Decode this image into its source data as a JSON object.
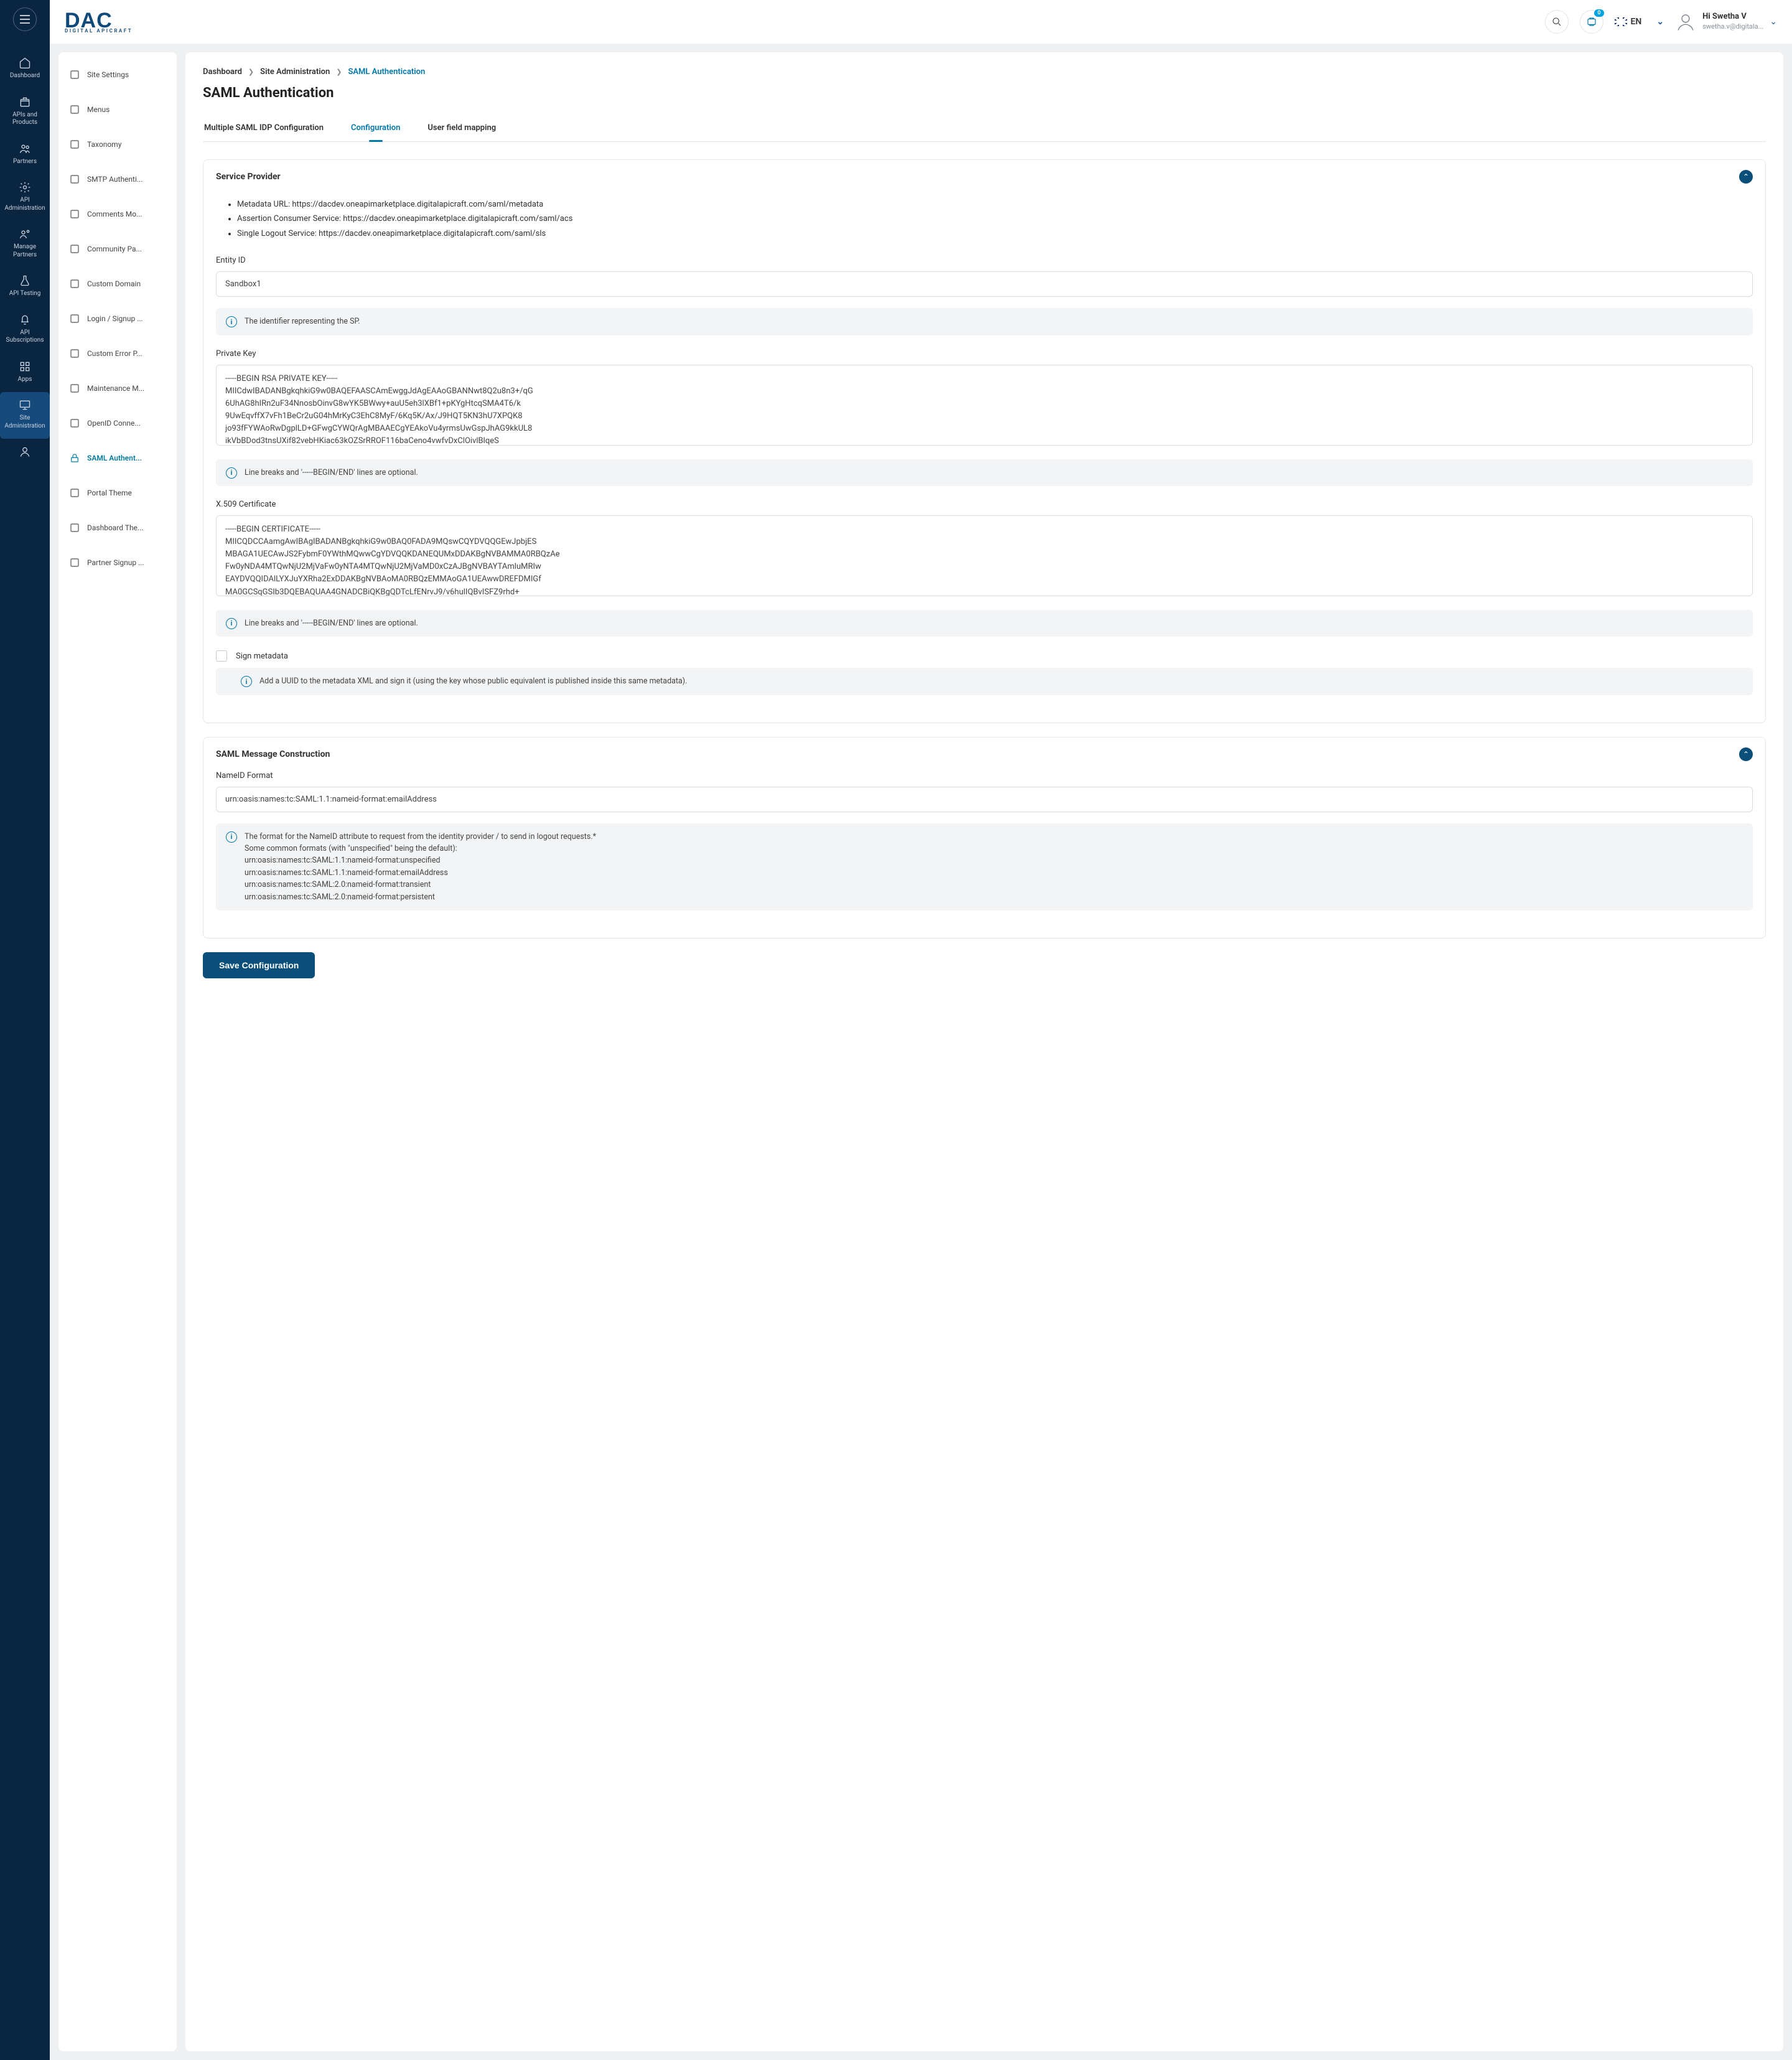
{
  "header": {
    "logo_main": "DAC",
    "logo_sub": "DIGITAL APICRAFT",
    "notif_badge": "0",
    "lang_label": "EN",
    "user_greeting": "Hi Swetha V",
    "user_email": "swetha.v@digitala..."
  },
  "rail": [
    {
      "label": "Dashboard",
      "icon": "home"
    },
    {
      "label": "APIs and Products",
      "icon": "package"
    },
    {
      "label": "Partners",
      "icon": "users"
    },
    {
      "label": "API Administration",
      "icon": "gear"
    },
    {
      "label": "Manage Partners",
      "icon": "gear-users"
    },
    {
      "label": "API Testing",
      "icon": "flask"
    },
    {
      "label": "API Subscriptions",
      "icon": "bell"
    },
    {
      "label": "Apps",
      "icon": "grid"
    },
    {
      "label": "Site Administration",
      "icon": "monitor",
      "active": true
    },
    {
      "label": "",
      "icon": "person"
    }
  ],
  "settings_nav": [
    {
      "label": "Site Settings",
      "icon": "gear"
    },
    {
      "label": "Menus",
      "icon": "grid"
    },
    {
      "label": "Taxonomy",
      "icon": "branch"
    },
    {
      "label": "SMTP Authenti...",
      "icon": "mail-lock"
    },
    {
      "label": "Comments Mo...",
      "icon": "chat"
    },
    {
      "label": "Community Pa...",
      "icon": "person"
    },
    {
      "label": "Custom Domain",
      "icon": "globe"
    },
    {
      "label": "Login / Signup ...",
      "icon": "login"
    },
    {
      "label": "Custom Error P...",
      "icon": "warning"
    },
    {
      "label": "Maintenance M...",
      "icon": "wrench"
    },
    {
      "label": "OpenID Conne...",
      "icon": "openid"
    },
    {
      "label": "SAML Authent...",
      "icon": "lock",
      "active": true
    },
    {
      "label": "Portal Theme",
      "icon": "theme"
    },
    {
      "label": "Dashboard The...",
      "icon": "dash-theme"
    },
    {
      "label": "Partner Signup ...",
      "icon": "signup"
    }
  ],
  "breadcrumbs": {
    "a": "Dashboard",
    "b": "Site Administration",
    "c": "SAML Authentication"
  },
  "page_title": "SAML Authentication",
  "tabs": [
    {
      "label": "Multiple SAML IDP Configuration"
    },
    {
      "label": "Configuration",
      "active": true
    },
    {
      "label": "User field mapping"
    }
  ],
  "sp": {
    "title": "Service Provider",
    "metadata": [
      "Metadata URL: https://dacdev.oneapimarketplace.digitalapicraft.com/saml/metadata",
      "Assertion Consumer Service: https://dacdev.oneapimarketplace.digitalapicraft.com/saml/acs",
      "Single Logout Service: https://dacdev.oneapimarketplace.digitalapicraft.com/saml/sls"
    ],
    "entity_id_label": "Entity ID",
    "entity_id_value": "Sandbox1",
    "entity_id_help": "The identifier representing the SP.",
    "private_key_label": "Private Key",
    "private_key_value": "-----BEGIN RSA PRIVATE KEY-----\nMIICdwIBADANBgkqhkiG9w0BAQEFAASCAmEwggJdAgEAAoGBANNwt8Q2u8n3+/qG\n6UhAG8hIRn2uF34NnosbOinvG8wYK5BWwy+auU5eh3lXBf1+pKYgHtcqSMA4T6/k\n9UwEqvffX7vFh1BeCr2uG04hMrKyC3EhC8MyF/6Kq5K/Ax/J9HQT5KN3hU7XPQK8\njo93fFYWAoRwDgplLD+GFwgCYWQrAgMBAAECgYEAkoVu4yrmsUwGspJhAG9kkUL8\nikVbBDod3tnsUXif82vebHKiac63kOZSrRROF116baCeno4vwfvDxClOivlBlqeS",
    "private_key_help": "Line breaks and '-----BEGIN/END' lines are optional.",
    "cert_label": "X.509 Certificate",
    "cert_value": "-----BEGIN CERTIFICATE-----\nMIICQDCCAamgAwIBAgIBADANBgkqhkiG9w0BAQ0FADA9MQswCQYDVQQGEwJpbjES\nMBAGA1UECAwJS2FybmF0YWthMQwwCgYDVQQKDANEQUMxDDAKBgNVBAMMA0RBQzAe\nFw0yNDA4MTQwNjU2MjVaFw0yNTA4MTQwNjU2MjVaMD0xCzAJBgNVBAYTAmluMRIw\nEAYDVQQIDAlLYXJuYXRha2ExDDAKBgNVBAoMA0RBQzEMMAoGA1UEAwwDREFDMIGf\nMA0GCSqGSIb3DQEBAQUAA4GNADCBiQKBgQDTcLfENrvJ9/v6hulIQBvISFZ9rhd+",
    "cert_help": "Line breaks and '-----BEGIN/END' lines are optional.",
    "sign_metadata_label": "Sign metadata",
    "sign_metadata_help": "Add a UUID to the metadata XML and sign it (using the key whose public equivalent is published inside this same metadata)."
  },
  "msg": {
    "title": "SAML Message Construction",
    "nameid_label": "NameID Format",
    "nameid_value": "urn:oasis:names:tc:SAML:1.1:nameid-format:emailAddress",
    "nameid_help": "The format for the NameID attribute to request from the identity provider / to send in logout requests.*\nSome common formats (with \"unspecified\" being the default):\nurn:oasis:names:tc:SAML:1.1:nameid-format:unspecified\nurn:oasis:names:tc:SAML:1.1:nameid-format:emailAddress\nurn:oasis:names:tc:SAML:2.0:nameid-format:transient\nurn:oasis:names:tc:SAML:2.0:nameid-format:persistent"
  },
  "save_label": "Save Configuration"
}
